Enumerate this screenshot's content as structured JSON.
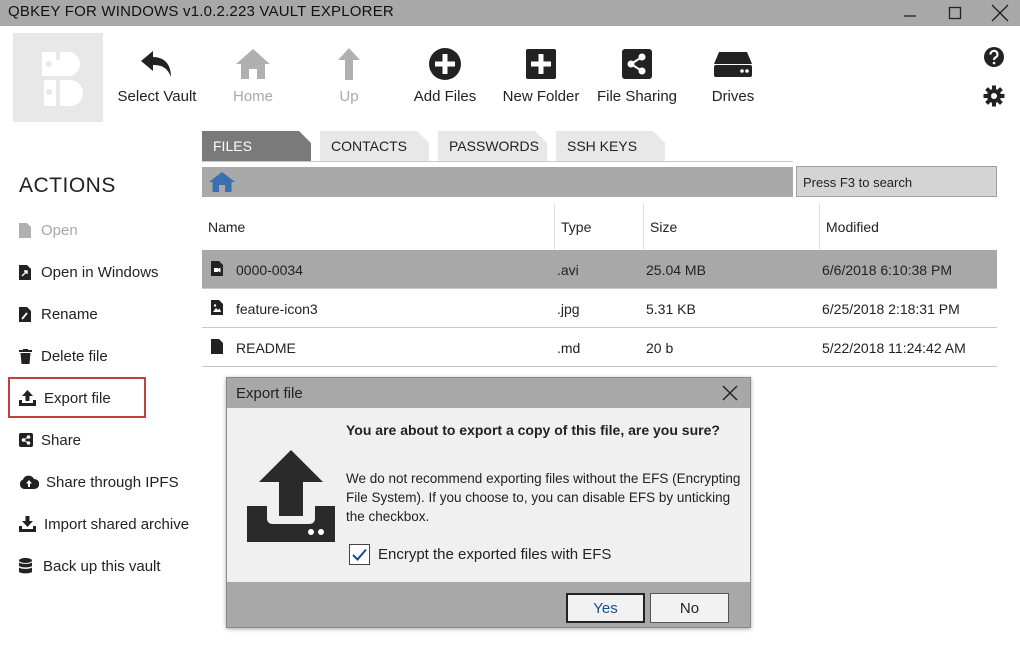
{
  "window": {
    "title": "QBKEY FOR WINDOWS v1.0.2.223  VAULT EXPLORER"
  },
  "toolbar": {
    "items": [
      {
        "label": "Select Vault",
        "icon": "undo-arrow-icon",
        "enabled": true
      },
      {
        "label": "Home",
        "icon": "home-icon",
        "enabled": false
      },
      {
        "label": "Up",
        "icon": "up-arrow-icon",
        "enabled": false
      },
      {
        "label": "Add Files",
        "icon": "plus-circle-icon",
        "enabled": true
      },
      {
        "label": "New Folder",
        "icon": "plus-square-icon",
        "enabled": true
      },
      {
        "label": "File Sharing",
        "icon": "share-icon",
        "enabled": true
      },
      {
        "label": "Drives",
        "icon": "drive-icon",
        "enabled": true
      }
    ]
  },
  "tabs": [
    {
      "label": "FILES",
      "active": true
    },
    {
      "label": "CONTACTS",
      "active": false
    },
    {
      "label": "PASSWORDS",
      "active": false
    },
    {
      "label": "SSH KEYS",
      "active": false
    }
  ],
  "search": {
    "placeholder": "Press F3 to search"
  },
  "actions": {
    "title": "ACTIONS",
    "items": [
      {
        "label": "Open",
        "enabled": false
      },
      {
        "label": "Open in Windows",
        "enabled": true
      },
      {
        "label": "Rename",
        "enabled": true
      },
      {
        "label": "Delete file",
        "enabled": true
      },
      {
        "label": "Export file",
        "enabled": true,
        "highlighted": true
      },
      {
        "label": "Share",
        "enabled": true
      },
      {
        "label": "Share through IPFS",
        "enabled": true
      },
      {
        "label": "Import shared archive",
        "enabled": true
      },
      {
        "label": "Back up this vault",
        "enabled": true
      }
    ]
  },
  "table": {
    "columns": [
      "Name",
      "Type",
      "Size",
      "Modified"
    ],
    "rows": [
      {
        "name": "0000-0034",
        "type": ".avi",
        "size": "25.04 MB",
        "modified": "6/6/2018 6:10:38 PM",
        "selected": true
      },
      {
        "name": "feature-icon3",
        "type": ".jpg",
        "size": "5.31 KB",
        "modified": "6/25/2018 2:18:31 PM",
        "selected": false
      },
      {
        "name": "README",
        "type": ".md",
        "size": "20 b",
        "modified": "5/22/2018 11:24:42 AM",
        "selected": false
      }
    ]
  },
  "dialog": {
    "title": "Export file",
    "heading": "You are about to export a copy of this file, are you sure?",
    "body": "We do not recommend exporting files without the EFS (Encrypting File System). If you choose to, you can disable EFS by unticking the checkbox.",
    "checkbox_label": "Encrypt the exported files with EFS",
    "checkbox_checked": true,
    "yes_label": "Yes",
    "no_label": "No"
  },
  "colors": {
    "titlebar": "#a8a8a8",
    "tab_active": "#7a7a7a",
    "highlight_border": "#c04040",
    "yes_text": "#1a4d8f",
    "home_icon": "#3a6fb0"
  }
}
